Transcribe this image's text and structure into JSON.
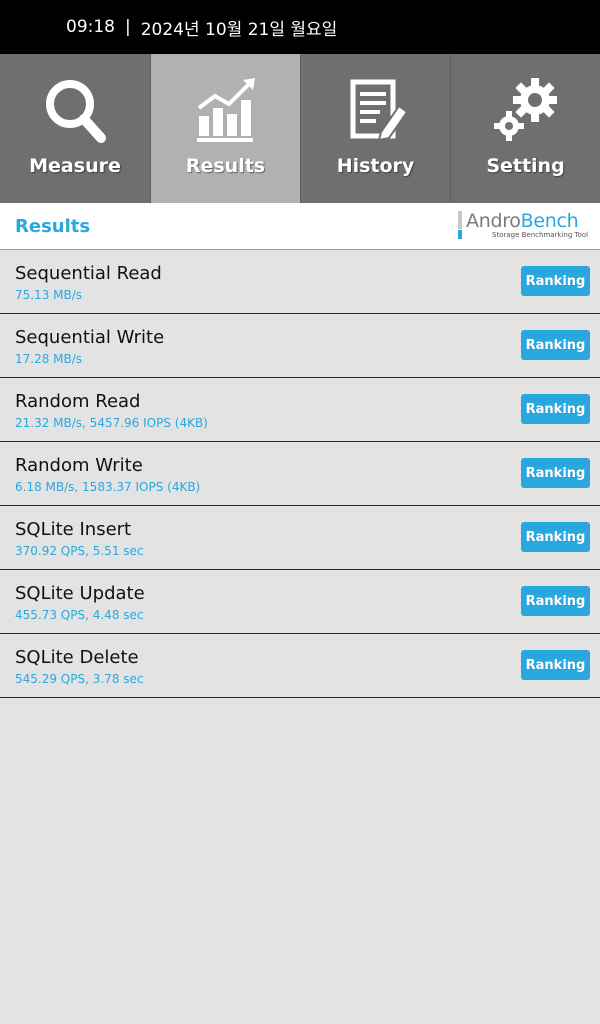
{
  "status_bar": {
    "time": "09:18",
    "separator": "|",
    "date": "2024년 10월 21일 월요일"
  },
  "tabs": [
    {
      "label": "Measure",
      "icon": "magnifier-icon",
      "active": false
    },
    {
      "label": "Results",
      "icon": "bar-chart-trend-icon",
      "active": true
    },
    {
      "label": "History",
      "icon": "document-pencil-icon",
      "active": false
    },
    {
      "label": "Setting",
      "icon": "gears-icon",
      "active": false
    }
  ],
  "header": {
    "title": "Results",
    "logo": {
      "brand_part1": "Andro",
      "brand_part2": "Bench",
      "tagline": "Storage Benchmarking Tool"
    }
  },
  "results": [
    {
      "name": "Sequential Read",
      "value": "75.13 MB/s",
      "button": "Ranking"
    },
    {
      "name": "Sequential Write",
      "value": "17.28 MB/s",
      "button": "Ranking"
    },
    {
      "name": "Random Read",
      "value": "21.32 MB/s, 5457.96 IOPS (4KB)",
      "button": "Ranking"
    },
    {
      "name": "Random Write",
      "value": "6.18 MB/s, 1583.37 IOPS (4KB)",
      "button": "Ranking"
    },
    {
      "name": "SQLite Insert",
      "value": "370.92 QPS, 5.51 sec",
      "button": "Ranking"
    },
    {
      "name": "SQLite Update",
      "value": "455.73 QPS, 4.48 sec",
      "button": "Ranking"
    },
    {
      "name": "SQLite Delete",
      "value": "545.29 QPS, 3.78 sec",
      "button": "Ranking"
    }
  ],
  "colors": {
    "accent": "#2aa8de",
    "tab_bg": "#6f6f6f",
    "tab_active_bg": "#b1b1b1",
    "list_bg": "#e3e3e3"
  }
}
